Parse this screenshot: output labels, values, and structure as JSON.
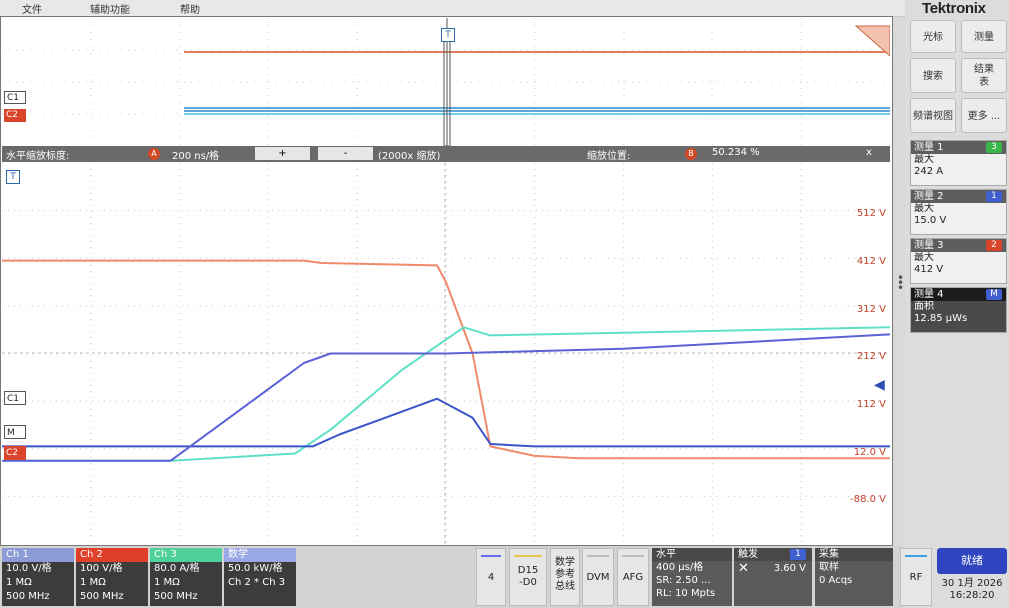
{
  "menu": [
    "文件",
    "辅助功能",
    "帮助"
  ],
  "brand": "Tektronix",
  "right_buttons": {
    "cursor": "光标",
    "measure": "测量",
    "search": "搜索",
    "results_line1": "结果",
    "results_line2": "表",
    "freq_analysis": "频谱视图",
    "more": "更多 ..."
  },
  "measurements": [
    {
      "title": "测量 1",
      "badge": "3",
      "badge_color": "#39b54a",
      "type": "最大",
      "value": "242 A"
    },
    {
      "title": "测量 2",
      "badge": "1",
      "badge_color": "#3f5fcf",
      "type": "最大",
      "value": "15.0 V"
    },
    {
      "title": "测量 3",
      "badge": "2",
      "badge_color": "#d9442a",
      "type": "最大",
      "value": "412 V"
    },
    {
      "title": "测量 4",
      "badge": "M",
      "badge_color": "#3f5fcf",
      "type": "面积",
      "value": "12.85 µWs"
    }
  ],
  "zoom_bar": {
    "scale_label": "水平缩放标度:",
    "scale_value": "200 ns/格",
    "plus": "+",
    "minus": "-",
    "zoom_factor": "(2000x 缩放)",
    "position_label": "缩放位置:",
    "position_value": "50.234 %",
    "close": "x"
  },
  "overview_labels": {
    "c1": "C1",
    "c2": "C2",
    "trigger": "T"
  },
  "plot_labels": {
    "trigger": "T",
    "c1": "C1",
    "m": "M",
    "c2": "C2"
  },
  "y_scale_labels": [
    "512 V",
    "412 V",
    "312 V",
    "212 V",
    "112 V",
    "12.0 V",
    "-88.0 V"
  ],
  "channels": [
    {
      "name": "Ch 1",
      "header_color": "#8a9bd6",
      "lines": [
        "10.0 V/格",
        "1 MΩ",
        "500 MHz"
      ]
    },
    {
      "name": "Ch 2",
      "header_color": "#e0402a",
      "lines": [
        "100 V/格",
        "1 MΩ",
        "500 MHz"
      ]
    },
    {
      "name": "Ch 3",
      "header_color": "#4fcf9a",
      "lines": [
        "80.0 A/格",
        "1 MΩ",
        "500 MHz"
      ]
    },
    {
      "name": "数学",
      "header_color": "#9aa7e6",
      "lines": [
        "50.0 kW/格",
        "Ch 2 * Ch 3"
      ]
    }
  ],
  "bottom_buttons": {
    "ref": "4",
    "digital_line1": "D15",
    "digital_line2": "-D0",
    "math_ref_bus_1": "数学",
    "math_ref_bus_2": "参考",
    "math_ref_bus_3": "总线",
    "dvm": "DVM",
    "afg": "AFG"
  },
  "horizontal": {
    "title": "水平",
    "lines": [
      "400 µs/格",
      "SR: 2.50 ...",
      "RL: 10 Mpts"
    ]
  },
  "trigger": {
    "title": "触发",
    "badge": "1",
    "value": "3.60 V"
  },
  "acquisition": {
    "title": "采集",
    "lines": [
      "取样",
      "0 Acqs"
    ]
  },
  "rf": "RF",
  "status": {
    "label": "就绪",
    "date": "30 1月 2026",
    "time": "16:28:20"
  },
  "colors": {
    "ch1": "#3a55c8",
    "ch2": "#f08a6c",
    "ch3": "#5ee0c6",
    "math": "#5b62d6",
    "ch2_label": "#d9442a"
  },
  "chart_data": {
    "type": "line",
    "title": "",
    "xlabel": "",
    "ylabel": "",
    "x_divisions": 10,
    "y_divisions": 8,
    "series": [
      {
        "name": "C2",
        "color": "#f08a6c",
        "x": [
          0,
          3.4,
          3.6,
          4.9,
          5.0,
          5.3,
          5.5,
          6.0,
          6.5,
          10
        ],
        "y": [
          1.95,
          1.95,
          1.9,
          1.85,
          1.5,
          0.0,
          -1.95,
          -2.15,
          -2.2,
          -2.2
        ]
      },
      {
        "name": "C3",
        "color": "#5ee0c6",
        "x": [
          0,
          1.9,
          3.3,
          3.7,
          4.5,
          5.2,
          5.5,
          10
        ],
        "y": [
          -2.25,
          -2.25,
          -2.1,
          -1.6,
          -0.35,
          0.55,
          0.38,
          0.55
        ]
      },
      {
        "name": "C1",
        "color": "#3a55c8",
        "x": [
          0,
          3.5,
          3.8,
          4.9,
          5.3,
          5.5,
          6.0,
          10
        ],
        "y": [
          -1.95,
          -1.95,
          -1.7,
          -0.95,
          -1.35,
          -1.9,
          -1.95,
          -1.95
        ]
      },
      {
        "name": "M",
        "color": "#5b62d6",
        "x": [
          0,
          1.9,
          3.4,
          3.7,
          5.0,
          7.0,
          10
        ],
        "y": [
          -2.25,
          -2.25,
          -0.2,
          0.0,
          0.0,
          0.1,
          0.4
        ]
      }
    ]
  }
}
